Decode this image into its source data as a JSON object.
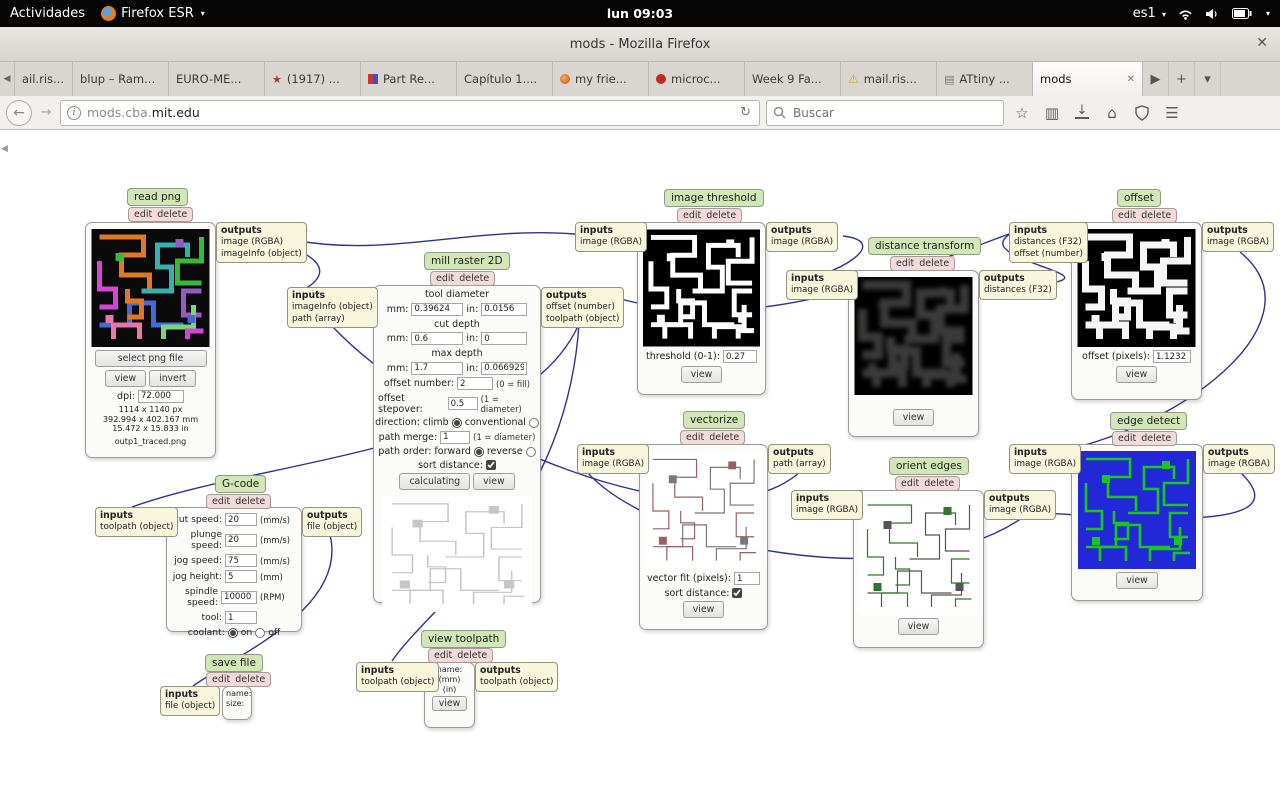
{
  "system_bar": {
    "activities": "Actividades",
    "app_name": "Firefox ESR",
    "clock": "lun 09:03",
    "keyboard": "es1"
  },
  "window": {
    "title": "mods - Mozilla Firefox"
  },
  "tab_bar": {
    "tabs": [
      {
        "label": "ail.ris..."
      },
      {
        "label": "blup – Ram..."
      },
      {
        "label": "EURO-ME..."
      },
      {
        "label": "(1917) ...",
        "favicon": "red-star"
      },
      {
        "label": "Part Re...",
        "favicon": "flag"
      },
      {
        "label": "Capítulo 1...."
      },
      {
        "label": "my frie...",
        "favicon": "orange-dot"
      },
      {
        "label": "microc...",
        "favicon": "red-dot"
      },
      {
        "label": "Week 9 Fa..."
      },
      {
        "label": "mail.ris...",
        "favicon": "warning"
      },
      {
        "label": "ATtiny ...",
        "favicon": "book"
      },
      {
        "label": "mods",
        "active": true
      }
    ]
  },
  "navbar": {
    "url_prefix": "mods.cba.",
    "url_domain": "mit.edu",
    "search_placeholder": "Buscar"
  },
  "graph": {
    "read_png": {
      "title": "read png",
      "edit": "edit",
      "delete": "delete",
      "select_file": "select png file",
      "view": "view",
      "invert": "invert",
      "dpi_label": "dpi:",
      "dpi": "72.000",
      "size_px": "1114 x 1140 px",
      "size_mm": "392.994 x 402.167 mm",
      "size_in": "15.472 x 15.833 in",
      "filename": "outp1_traced.png",
      "outputs": {
        "title": "outputs",
        "lines": [
          "image (RGBA)",
          "imageInfo (object)"
        ]
      }
    },
    "mill_raster": {
      "title": "mill raster 2D",
      "edit": "edit",
      "delete": "delete",
      "inputs": {
        "title": "inputs",
        "lines": [
          "imageInfo (object)",
          "path (array)"
        ]
      },
      "outputs": {
        "title": "outputs",
        "lines": [
          "offset (number)",
          "toolpath (object)"
        ]
      },
      "mm_label": "mm:",
      "in_label": "in:",
      "sections": {
        "tool_diameter": {
          "label": "tool diameter",
          "mm": "0.39624",
          "in": "0.0156"
        },
        "cut_depth": {
          "label": "cut depth",
          "mm": "0.6",
          "in": "0"
        },
        "max_depth": {
          "label": "max depth",
          "mm": "1.7",
          "in": "0.066929"
        }
      },
      "offset_number": {
        "label": "offset number:",
        "value": "2",
        "note": "(0 = fill)"
      },
      "offset_stepover": {
        "label": "offset stepover:",
        "value": "0.5",
        "note": "(1 = diameter)"
      },
      "direction": {
        "label": "direction:",
        "opt1": "climb",
        "opt2": "conventional",
        "selected": "climb"
      },
      "path_merge": {
        "label": "path merge:",
        "value": "1",
        "note": "(1 = diameter)"
      },
      "path_order": {
        "label": "path order: forward",
        "opt2": "reverse",
        "selected": "forward"
      },
      "sort_distance_label": "sort distance:",
      "sort_checked": true,
      "calculating": "calculating",
      "view": "view"
    },
    "image_threshold": {
      "title": "image threshold",
      "edit": "edit",
      "delete": "delete",
      "inputs": {
        "title": "inputs",
        "lines": [
          "image (RGBA)"
        ]
      },
      "outputs": {
        "title": "outputs",
        "lines": [
          "image (RGBA)"
        ]
      },
      "threshold_label": "threshold (0-1):",
      "threshold": "0.27",
      "view": "view"
    },
    "distance_transform": {
      "title": "distance transform",
      "edit": "edit",
      "delete": "delete",
      "inputs": {
        "title": "inputs",
        "lines": [
          "image (RGBA)"
        ]
      },
      "outputs": {
        "title": "outputs",
        "lines": [
          "distances (F32)"
        ]
      },
      "view": "view"
    },
    "offset": {
      "title": "offset",
      "edit": "edit",
      "delete": "delete",
      "inputs": {
        "title": "inputs",
        "lines": [
          "distances (F32)",
          "offset (number)"
        ]
      },
      "outputs": {
        "title": "outputs",
        "lines": [
          "image (RGBA)"
        ]
      },
      "offset_label": "offset (pixels):",
      "offset_value": "1.1232",
      "view": "view"
    },
    "vectorize": {
      "title": "vectorize",
      "edit": "edit",
      "delete": "delete",
      "inputs": {
        "title": "inputs",
        "lines": [
          "image (RGBA)"
        ]
      },
      "outputs": {
        "title": "outputs",
        "lines": [
          "path (array)"
        ]
      },
      "fit_label": "vector fit (pixels):",
      "fit_value": "1",
      "sort_distance_label": "sort distance:",
      "sort_checked": true,
      "view": "view"
    },
    "orient_edges": {
      "title": "orient edges",
      "edit": "edit",
      "delete": "delete",
      "inputs": {
        "title": "inputs",
        "lines": [
          "image (RGBA)"
        ]
      },
      "outputs": {
        "title": "outputs",
        "lines": [
          "image (RGBA)"
        ]
      },
      "view": "view"
    },
    "edge_detect": {
      "title": "edge detect",
      "edit": "edit",
      "delete": "delete",
      "inputs": {
        "title": "inputs",
        "lines": [
          "image (RGBA)"
        ]
      },
      "outputs": {
        "title": "outputs",
        "lines": [
          "image (RGBA)"
        ]
      },
      "view": "view"
    },
    "gcode": {
      "title": "G-code",
      "edit": "edit",
      "delete": "delete",
      "inputs": {
        "title": "inputs",
        "lines": [
          "toolpath (object)"
        ]
      },
      "outputs": {
        "title": "outputs",
        "lines": [
          "file (object)"
        ]
      },
      "rows": [
        {
          "label": "cut speed:",
          "value": "20",
          "unit": "(mm/s)"
        },
        {
          "label": "plunge speed:",
          "value": "20",
          "unit": "(mm/s)"
        },
        {
          "label": "jog speed:",
          "value": "75",
          "unit": "(mm/s)"
        },
        {
          "label": "jog height:",
          "value": "5",
          "unit": "(mm)"
        },
        {
          "label": "spindle speed:",
          "value": "10000",
          "unit": "(RPM)"
        },
        {
          "label": "tool:",
          "value": "1",
          "unit": ""
        }
      ],
      "coolant": {
        "label": "coolant:",
        "opt1": "on",
        "opt2": "off",
        "selected": "on"
      }
    },
    "save_file": {
      "title": "save file",
      "edit": "edit",
      "delete": "delete",
      "inputs": {
        "title": "inputs",
        "lines": [
          "file (object)"
        ]
      },
      "name_label": "name:",
      "size_label": "size:"
    },
    "view_toolpath": {
      "title": "view toolpath",
      "edit": "edit",
      "delete": "delete",
      "inputs": {
        "title": "inputs",
        "lines": [
          "toolpath (object)"
        ]
      },
      "outputs": {
        "title": "outputs",
        "lines": [
          "toolpath (object)"
        ]
      },
      "name_label": "name:",
      "mm_label": "(mm)",
      "in_label": "(in)",
      "view": "view"
    }
  }
}
